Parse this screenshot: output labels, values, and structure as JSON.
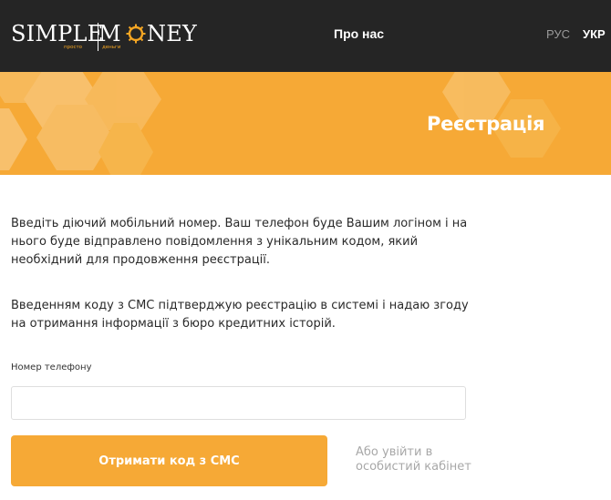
{
  "header": {
    "logo": {
      "word1": "SIMPLE",
      "word2": "M",
      "word3": "NEY",
      "tagline1": "просто",
      "tagline2": "деньги"
    },
    "nav_about": "Про нас",
    "lang_ru": "РУС",
    "lang_ua": "УКР"
  },
  "banner": {
    "title": "Реєстрація"
  },
  "intro": {
    "line1": "Введіть діючий мобільний номер. Ваш телефон буде Вашим логіном і на",
    "line2": "нього буде відправлено повідомлення з унікальним кодом, який",
    "line3": "необхідний для продовження реєстрації."
  },
  "consent": {
    "line1": "Введенням коду з СМС підтверджую реєстрацію в системі і надаю згоду",
    "line2": "на отримання інформації з бюро кредитних історій."
  },
  "form": {
    "phone_label": "Номер телефону",
    "phone_value": "",
    "submit_label": "Отримати код з СМС",
    "login_line1": "Або увійти в",
    "login_line2": "особистий кабінет"
  },
  "colors": {
    "header_bg": "#252525",
    "accent": "#f6a936",
    "muted": "#a8a8a8"
  }
}
